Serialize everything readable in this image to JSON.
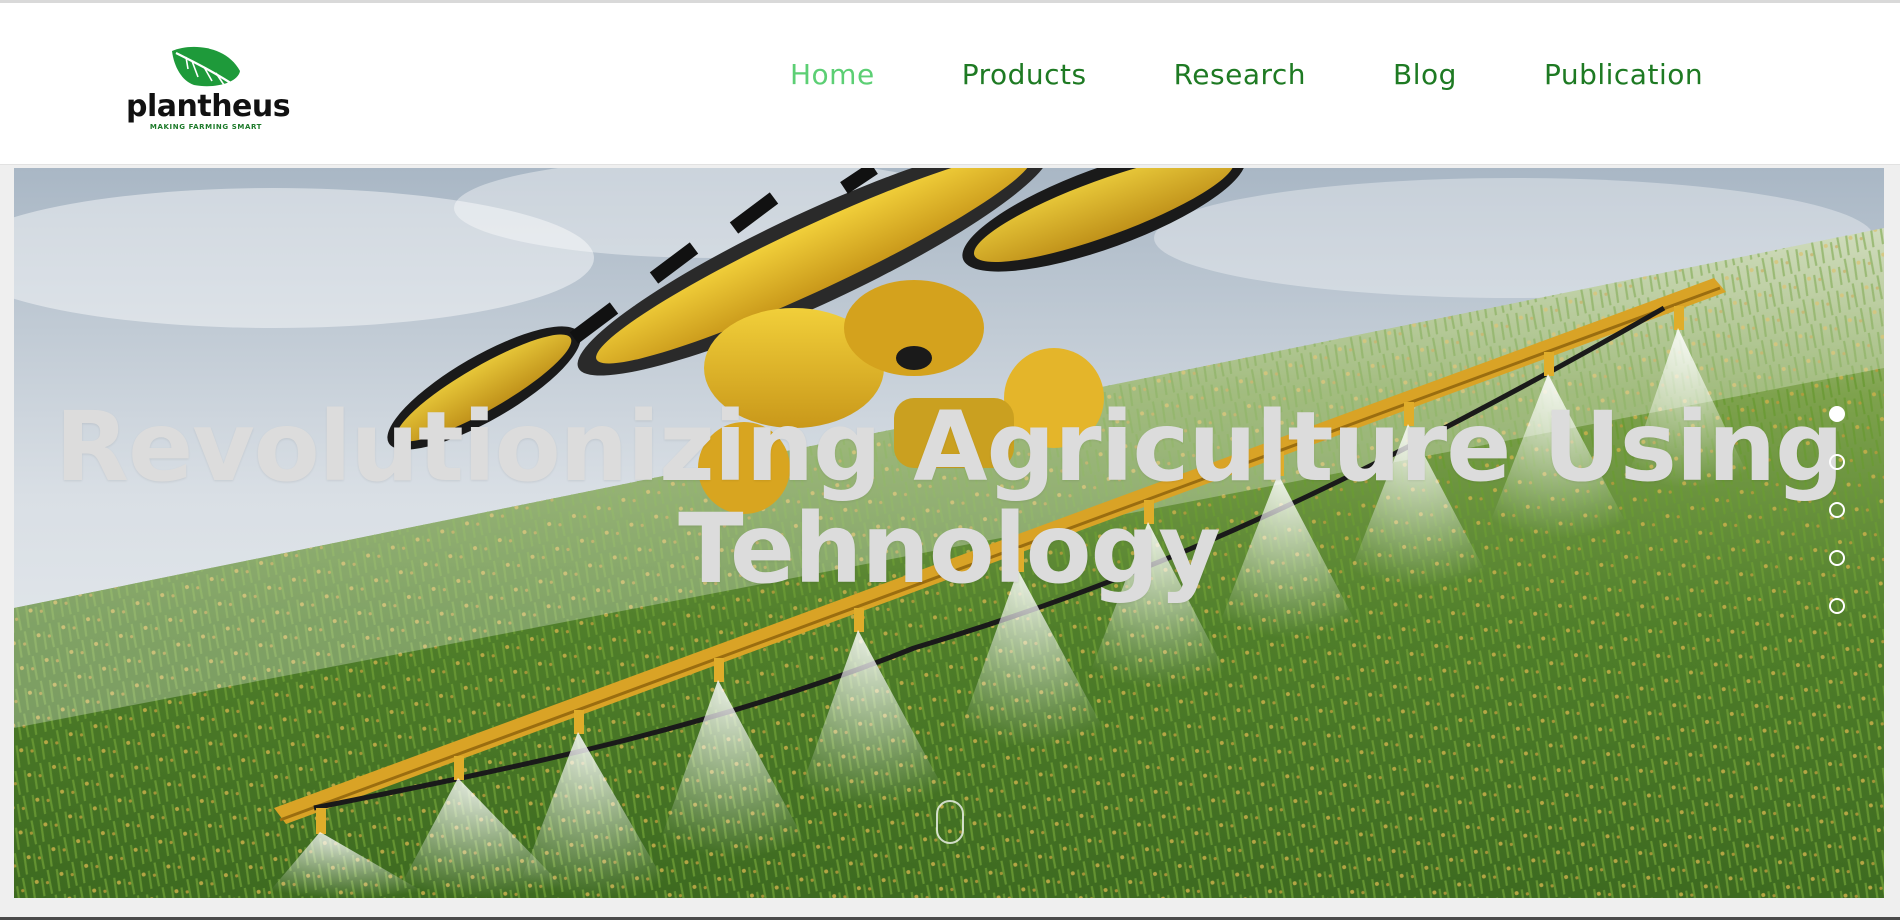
{
  "brand": {
    "name": "plantheus",
    "tagline": "MAKING FARMING SMART",
    "leaf_color": "#1e9a3a"
  },
  "nav": {
    "items": [
      {
        "label": "Home",
        "active": true
      },
      {
        "label": "Products",
        "active": false
      },
      {
        "label": "Research",
        "active": false
      },
      {
        "label": "Blog",
        "active": false
      },
      {
        "label": "Publication",
        "active": false
      }
    ],
    "active_color": "#5ccf74",
    "color": "#1e7a23"
  },
  "hero": {
    "headline_line1": "Revolutionizing Agriculture Using",
    "headline_line2": "Tehnology",
    "image": "agricultural drone spraying a corn field",
    "slide_count": 5,
    "active_slide": 1
  }
}
